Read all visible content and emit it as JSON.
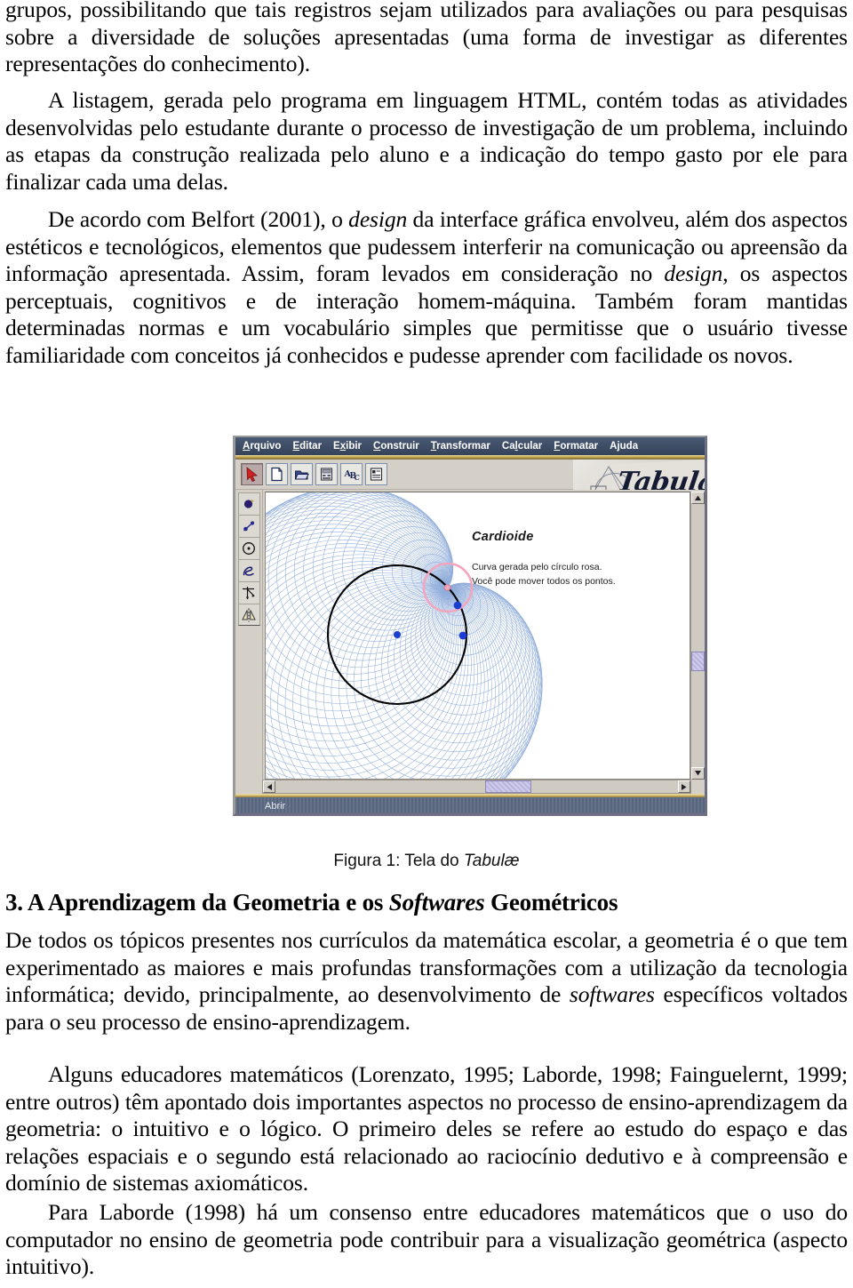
{
  "document": {
    "paragraphs": {
      "p1": "grupos, possibilitando que tais registros sejam utilizados para avaliações ou para pesquisas sobre a diversidade de soluções apresentadas (uma forma de investigar as diferentes representações do conhecimento).",
      "p2_part1": "A listagem, gerada pelo programa em linguagem HTML, contém todas as atividades desenvolvidas pelo estudante durante o processo de investigação de um problema, incluindo as etapas da construção realizada pelo aluno e a indicação do tempo gasto por ele para finalizar cada uma delas.",
      "p3_a": "De acordo com Belfort (2001), o ",
      "p3_i1": "design",
      "p3_b": " da interface gráfica envolveu, além dos aspectos estéticos e tecnológicos, elementos que pudessem interferir na comunicação ou apreensão da informação apresentada. Assim, foram levados em consideração no ",
      "p3_i2": "design",
      "p3_c": ", os aspectos perceptuais, cognitivos e de interação homem-máquina. Também foram mantidas determinadas normas e um vocabulário simples que permitisse que o usuário tivesse familiaridade com conceitos já conhecidos e pudesse aprender com facilidade os novos.",
      "p4_a": "De todos os tópicos presentes nos currículos da matemática escolar, a geometria é o que tem experimentado as maiores e mais profundas transformações com a utilização da tecnologia informática; devido, principalmente, ao desenvolvimento de ",
      "p4_i1": "softwares",
      "p4_b": " específicos voltados para o seu processo de ensino-aprendizagem.",
      "p5": "Alguns educadores matemáticos (Lorenzato, 1995; Laborde, 1998; Fainguelernt, 1999; entre outros) têm apontado dois importantes aspectos no processo de ensino-aprendizagem da geometria: o intuitivo e o lógico. O primeiro deles se refere ao estudo do espaço e das relações espaciais e o segundo está relacionado ao raciocínio dedutivo e à compreensão e domínio de sistemas axiomáticos.",
      "p6": "Para Laborde (1998) há um consenso entre educadores matemáticos que o uso do computador no ensino de geometria pode contribuir para a visualização geométrica (aspecto intuitivo)."
    },
    "figure": {
      "caption_prefix": "Figura 1: Tela do ",
      "caption_italic": "Tabulæ"
    },
    "heading": {
      "number_text": "3. A Aprendizagem da Geometria e os ",
      "italic_word": "Softwares",
      "tail": " Geométricos"
    }
  },
  "app": {
    "name": "Tabulæ",
    "logo_text": "Tabulæ",
    "menubar": [
      {
        "label": "Arquivo",
        "mnemonic": "A",
        "rest": "rquivo"
      },
      {
        "label": "Editar",
        "mnemonic": "E",
        "rest": "ditar"
      },
      {
        "label": "Exibir",
        "mnemonic": "E",
        "rest": "xibir"
      },
      {
        "label": "Construir",
        "mnemonic": "C",
        "rest": "onstruir"
      },
      {
        "label": "Transformar",
        "mnemonic": "T",
        "rest": "ransformar"
      },
      {
        "label": "Calcular",
        "mnemonic": "C",
        "rest": "alcular"
      },
      {
        "label": "Formatar",
        "mnemonic": "F",
        "rest": "ormatar"
      },
      {
        "label": "Ajuda",
        "mnemonic": "A",
        "rest": "juda"
      }
    ],
    "toolbar_top": [
      {
        "name": "pointer-tool",
        "selected": true
      },
      {
        "name": "new-document",
        "selected": false
      },
      {
        "name": "open-folder",
        "selected": false
      },
      {
        "name": "calculator",
        "selected": false
      },
      {
        "name": "text-abc",
        "selected": false
      },
      {
        "name": "properties-list",
        "selected": false
      }
    ],
    "toolbar_left": [
      {
        "name": "point-tool"
      },
      {
        "name": "segment-tool"
      },
      {
        "name": "circle-tool"
      },
      {
        "name": "locus-curve-tool"
      },
      {
        "name": "perpendicular-tool"
      },
      {
        "name": "reflection-tool"
      }
    ],
    "canvas": {
      "title": "Cardioide",
      "line1": "Curva gerada pelo círculo rosa.",
      "line2": "Você pode mover todos os pontos."
    },
    "statusbar": {
      "text": "Abrir"
    },
    "scrollbars": {
      "vertical_arrow_up": "▲",
      "vertical_arrow_down": "▼",
      "horizontal_arrow_left": "◄",
      "horizontal_arrow_right": "►"
    },
    "colors": {
      "menubar_bg": "#3b4a63",
      "gold_rule": "#c4a84e",
      "toolbar_bg": "#d4d0c8",
      "canvas_bg": "#ffffff",
      "statusbar_bg": "#5d6b84",
      "envelope_curve": "#7d9fd4",
      "base_circle": "#000000",
      "generator_circle": "#f0a0b8",
      "points": "#1a3fd0"
    }
  }
}
